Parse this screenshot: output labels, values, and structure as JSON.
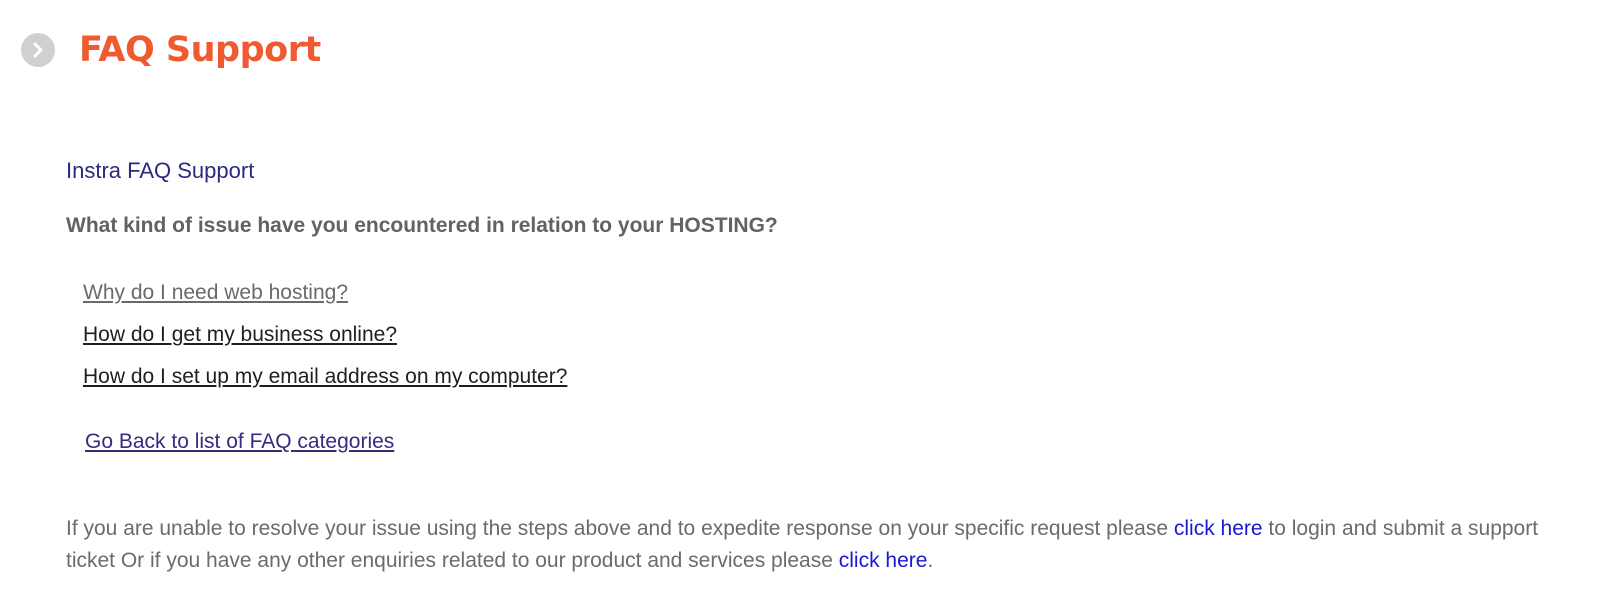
{
  "header": {
    "icon": "chevron-right-circle-icon",
    "title": "FAQ Support",
    "title_color": "#ef5a31"
  },
  "section": {
    "title": "Instra FAQ Support",
    "question": "What kind of issue have you encountered in relation to your HOSTING?"
  },
  "faq_links": [
    "Why do I need web hosting?",
    "How do I get my business online?",
    "How do I set up my email address on my computer?"
  ],
  "back_link": "Go Back to list of FAQ categories",
  "footer": {
    "text_1": "If you are unable to resolve your issue using the steps above and to expedite response on your specific request please ",
    "link_1": "click here",
    "text_2": " to login and submit a support ticket Or if you have any other enquiries related to our product and services please ",
    "link_2": "click here",
    "text_3": "."
  },
  "colors": {
    "accent": "#ef5a31",
    "heading": "#2b2a7e",
    "link": "#1a18d6",
    "body_text": "#6b6b6b"
  }
}
